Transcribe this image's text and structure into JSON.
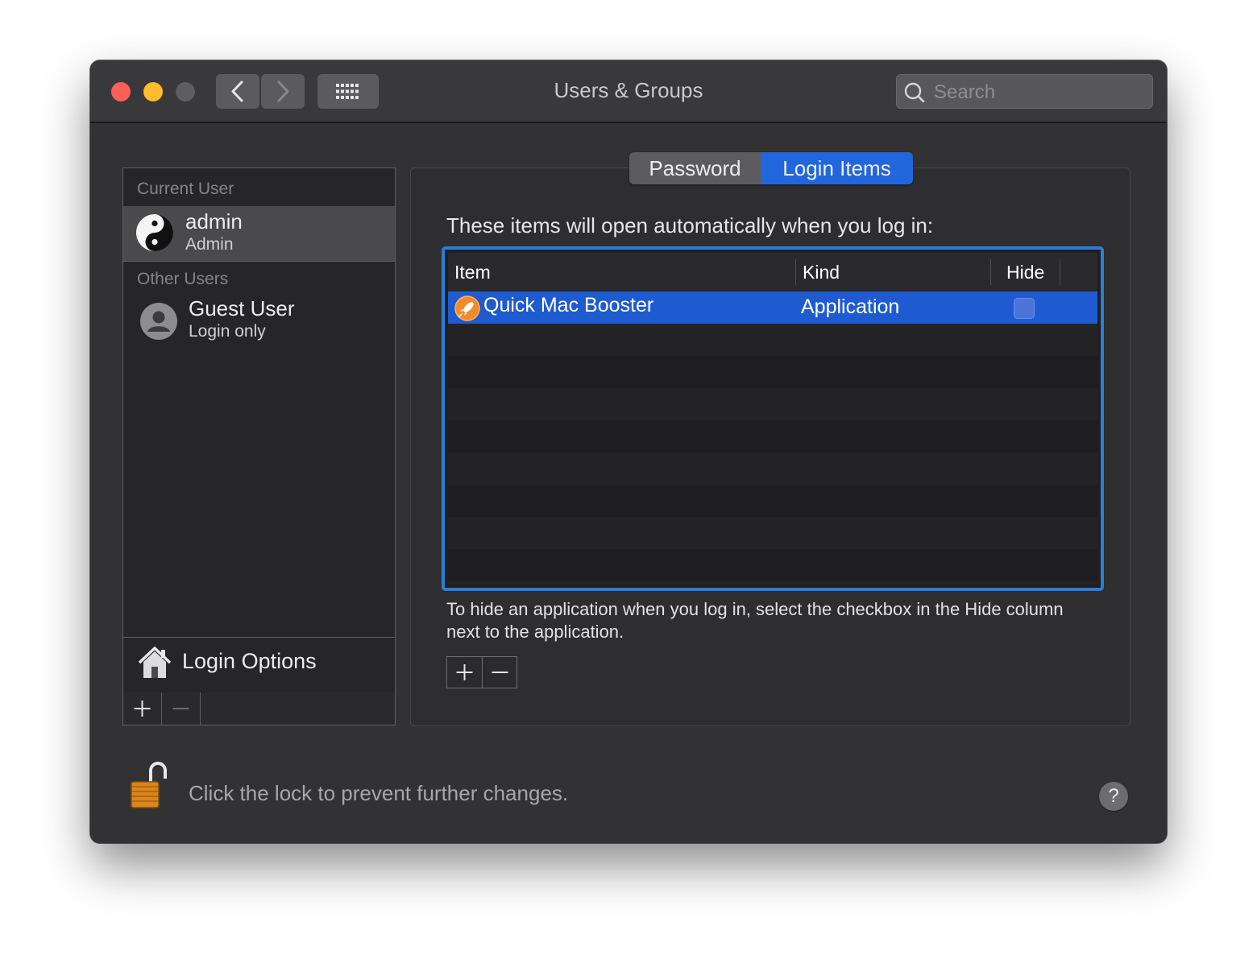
{
  "window": {
    "title": "Users & Groups"
  },
  "search": {
    "placeholder": "Search"
  },
  "sidebar": {
    "current_header": "Current User",
    "current_user": {
      "name": "admin",
      "role": "Admin"
    },
    "other_header": "Other Users",
    "other_users": [
      {
        "name": "Guest User",
        "role": "Login only"
      }
    ],
    "login_options": "Login Options"
  },
  "tabs": [
    {
      "label": "Password"
    },
    {
      "label": "Login Items",
      "active": true
    }
  ],
  "login_items": {
    "intro": "These items will open automatically when you log in:",
    "columns": {
      "item": "Item",
      "kind": "Kind",
      "hide": "Hide"
    },
    "rows": [
      {
        "item": "Quick Mac Booster",
        "kind": "Application",
        "hide": false
      }
    ],
    "hint": "To hide an application when you log in, select the checkbox in the Hide column next to the application."
  },
  "footer": {
    "lock_text": "Click the lock to prevent further changes.",
    "help": "?"
  },
  "colors": {
    "accent": "#2266db",
    "selection": "#1e5bd0",
    "focus_ring": "#2b7dd8"
  },
  "icons": [
    "back-chevron-icon",
    "forward-chevron-icon",
    "grid-icon",
    "search-icon",
    "yin-yang-avatar-icon",
    "person-icon",
    "house-icon",
    "plus-icon",
    "minus-icon",
    "rocket-icon",
    "unlocked-padlock-icon",
    "help-icon"
  ]
}
